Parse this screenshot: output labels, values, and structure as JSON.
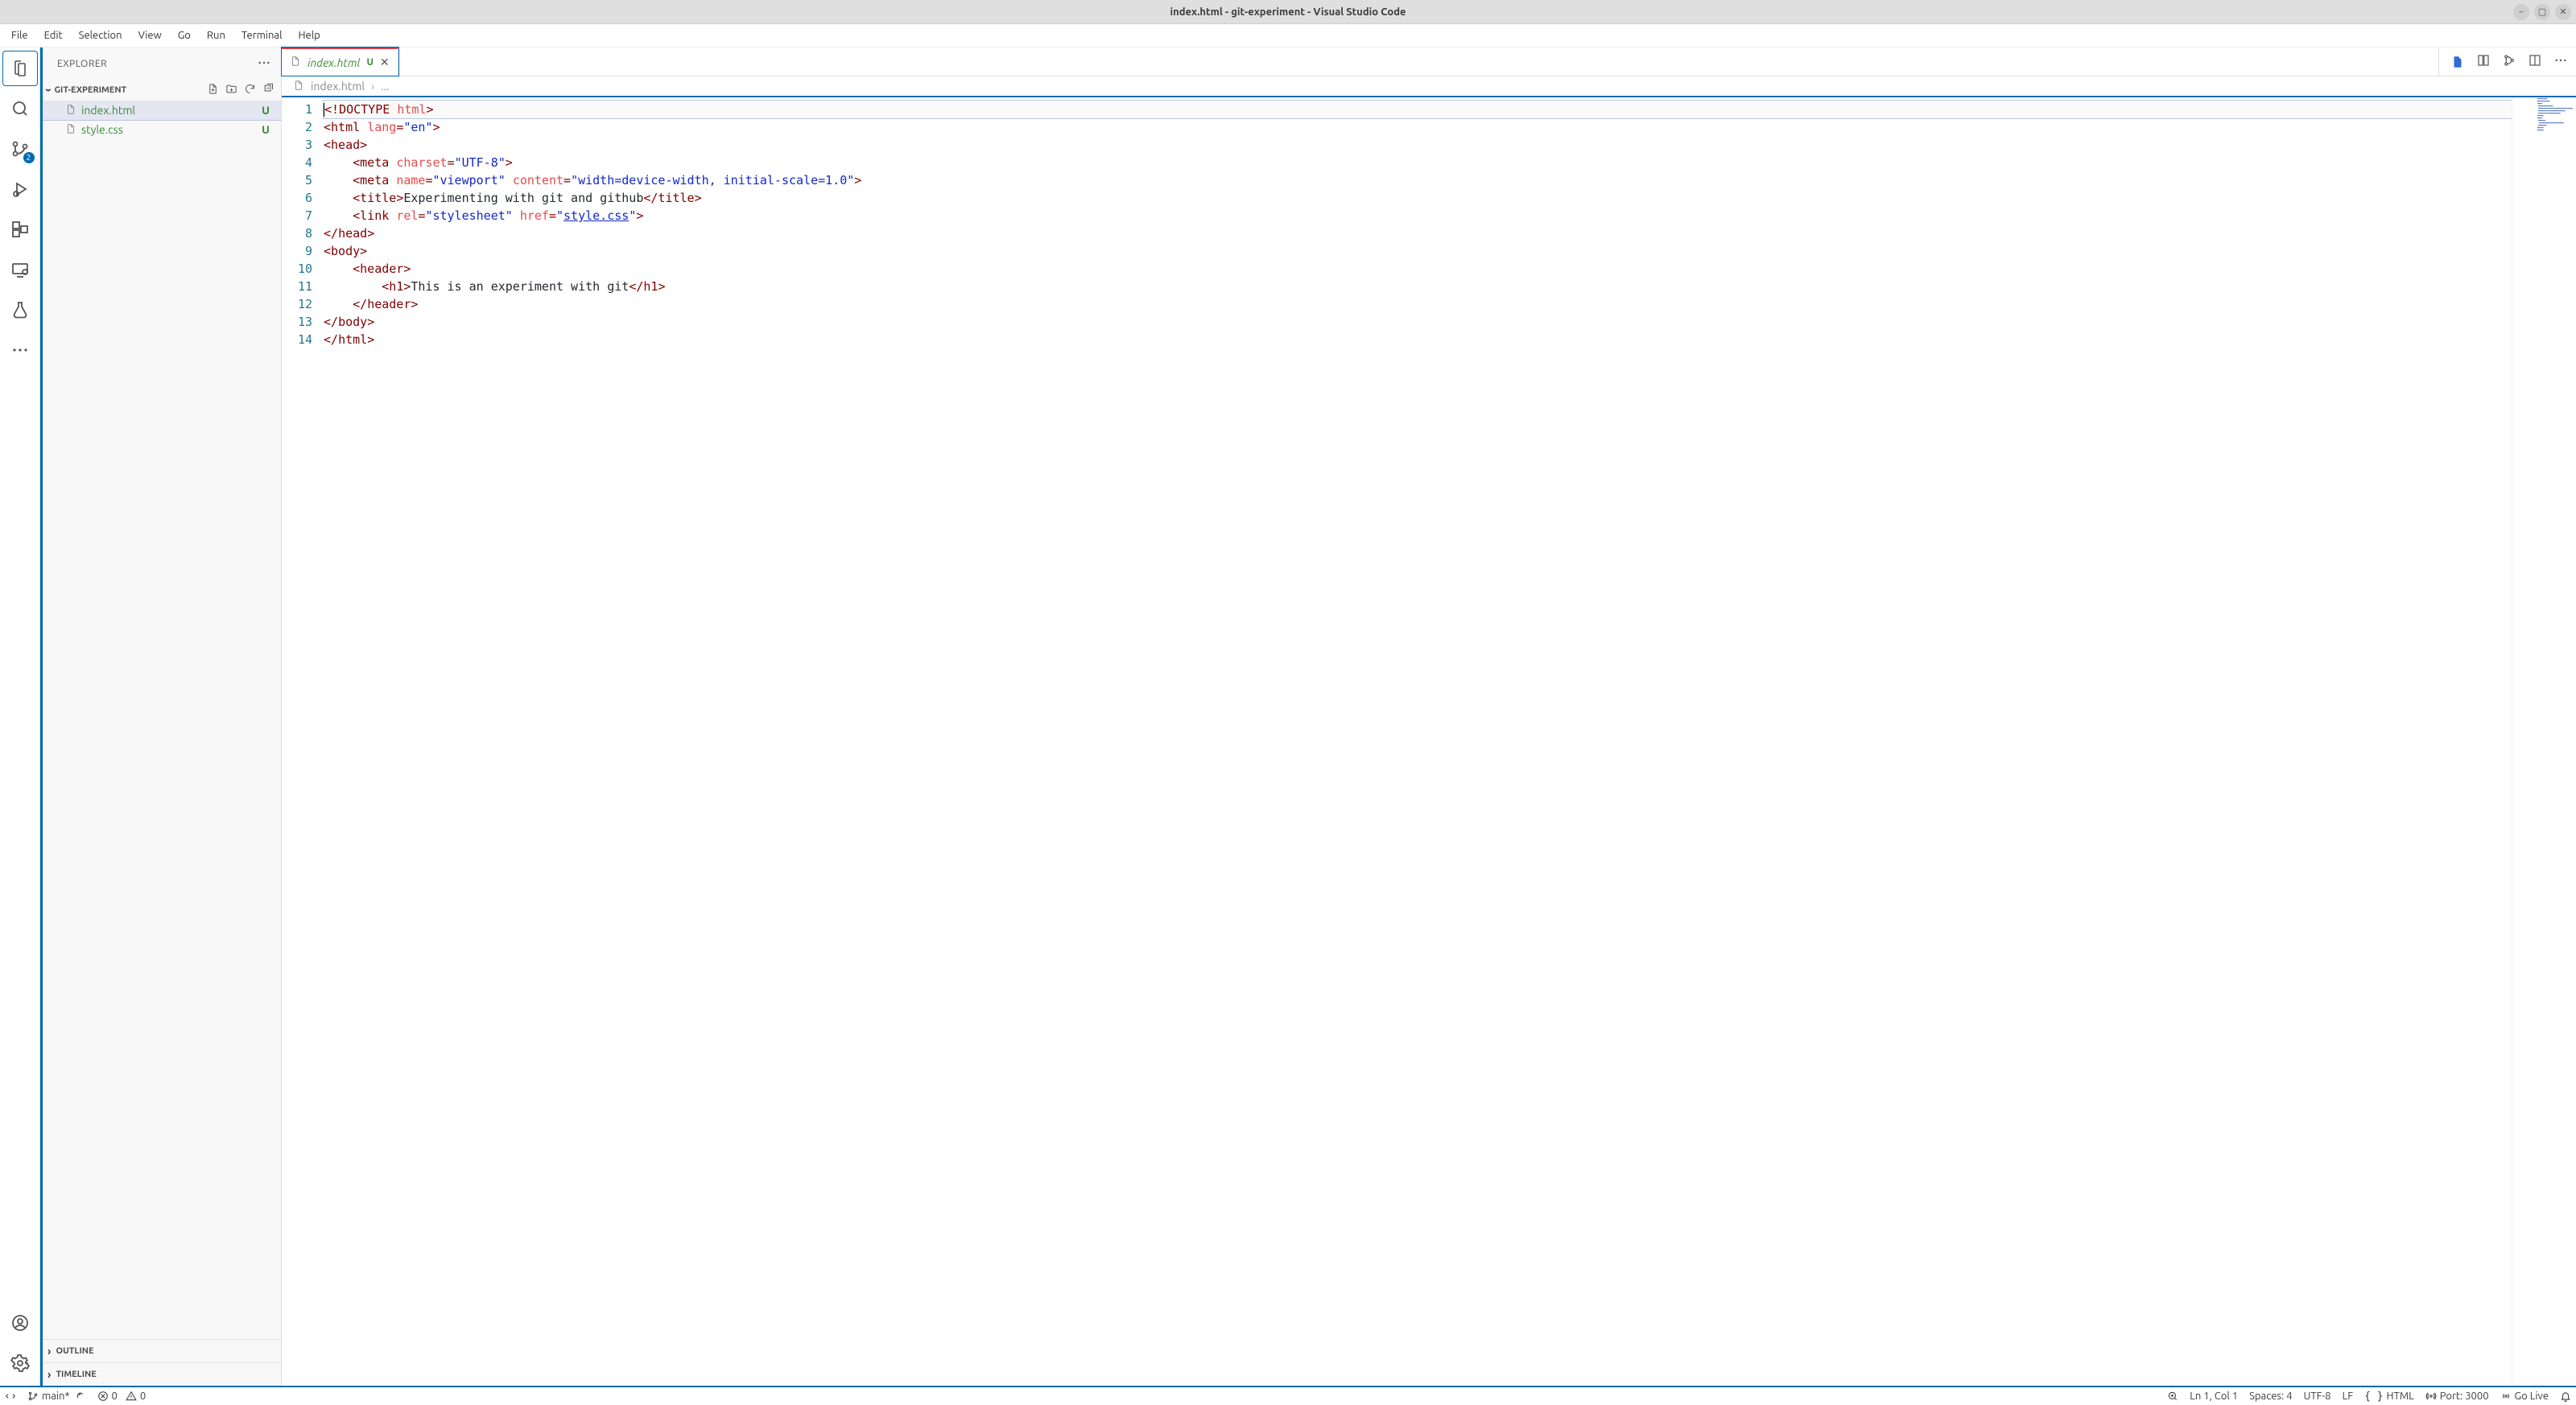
{
  "window": {
    "title": "index.html - git-experiment - Visual Studio Code"
  },
  "menu": [
    "File",
    "Edit",
    "Selection",
    "View",
    "Go",
    "Run",
    "Terminal",
    "Help"
  ],
  "activitybar": {
    "source_control_badge": "2"
  },
  "explorer": {
    "title": "EXPLORER",
    "folder": "GIT-EXPERIMENT",
    "files": [
      {
        "name": "index.html",
        "status": "U"
      },
      {
        "name": "style.css",
        "status": "U"
      }
    ],
    "sections": {
      "outline": "OUTLINE",
      "timeline": "TIMELINE"
    }
  },
  "tabs": [
    {
      "name": "index.html",
      "status": "U",
      "active": true
    }
  ],
  "breadcrumb": {
    "file": "index.html",
    "tail": "..."
  },
  "editor_lines": [
    [
      {
        "c": "p",
        "t": "<!"
      },
      {
        "c": "t",
        "t": "DOCTYPE"
      },
      {
        "c": "tx",
        "t": " "
      },
      {
        "c": "a",
        "t": "html"
      },
      {
        "c": "p",
        "t": ">"
      }
    ],
    [
      {
        "c": "p",
        "t": "<"
      },
      {
        "c": "t",
        "t": "html"
      },
      {
        "c": "tx",
        "t": " "
      },
      {
        "c": "a",
        "t": "lang"
      },
      {
        "c": "p",
        "t": "="
      },
      {
        "c": "v",
        "t": "\"en\""
      },
      {
        "c": "p",
        "t": ">"
      }
    ],
    [
      {
        "c": "p",
        "t": "<"
      },
      {
        "c": "t",
        "t": "head"
      },
      {
        "c": "p",
        "t": ">"
      }
    ],
    [
      {
        "c": "tx",
        "t": "    "
      },
      {
        "c": "p",
        "t": "<"
      },
      {
        "c": "t",
        "t": "meta"
      },
      {
        "c": "tx",
        "t": " "
      },
      {
        "c": "a",
        "t": "charset"
      },
      {
        "c": "p",
        "t": "="
      },
      {
        "c": "v",
        "t": "\"UTF-8\""
      },
      {
        "c": "p",
        "t": ">"
      }
    ],
    [
      {
        "c": "tx",
        "t": "    "
      },
      {
        "c": "p",
        "t": "<"
      },
      {
        "c": "t",
        "t": "meta"
      },
      {
        "c": "tx",
        "t": " "
      },
      {
        "c": "a",
        "t": "name"
      },
      {
        "c": "p",
        "t": "="
      },
      {
        "c": "v",
        "t": "\"viewport\""
      },
      {
        "c": "tx",
        "t": " "
      },
      {
        "c": "a",
        "t": "content"
      },
      {
        "c": "p",
        "t": "="
      },
      {
        "c": "v",
        "t": "\"width=device-width, initial-scale=1.0\""
      },
      {
        "c": "p",
        "t": ">"
      }
    ],
    [
      {
        "c": "tx",
        "t": "    "
      },
      {
        "c": "p",
        "t": "<"
      },
      {
        "c": "t",
        "t": "title"
      },
      {
        "c": "p",
        "t": ">"
      },
      {
        "c": "tx",
        "t": "Experimenting with git and github"
      },
      {
        "c": "p",
        "t": "</"
      },
      {
        "c": "t",
        "t": "title"
      },
      {
        "c": "p",
        "t": ">"
      }
    ],
    [
      {
        "c": "tx",
        "t": "    "
      },
      {
        "c": "p",
        "t": "<"
      },
      {
        "c": "t",
        "t": "link"
      },
      {
        "c": "tx",
        "t": " "
      },
      {
        "c": "a",
        "t": "rel"
      },
      {
        "c": "p",
        "t": "="
      },
      {
        "c": "v",
        "t": "\"stylesheet\""
      },
      {
        "c": "tx",
        "t": " "
      },
      {
        "c": "a",
        "t": "href"
      },
      {
        "c": "p",
        "t": "="
      },
      {
        "c": "v",
        "t": "\""
      },
      {
        "c": "v link",
        "t": "style.css"
      },
      {
        "c": "v",
        "t": "\""
      },
      {
        "c": "p",
        "t": ">"
      }
    ],
    [
      {
        "c": "p",
        "t": "</"
      },
      {
        "c": "t",
        "t": "head"
      },
      {
        "c": "p",
        "t": ">"
      }
    ],
    [
      {
        "c": "p",
        "t": "<"
      },
      {
        "c": "t",
        "t": "body"
      },
      {
        "c": "p",
        "t": ">"
      }
    ],
    [
      {
        "c": "tx",
        "t": "    "
      },
      {
        "c": "p",
        "t": "<"
      },
      {
        "c": "t",
        "t": "header"
      },
      {
        "c": "p",
        "t": ">"
      }
    ],
    [
      {
        "c": "tx",
        "t": "        "
      },
      {
        "c": "p",
        "t": "<"
      },
      {
        "c": "t",
        "t": "h1"
      },
      {
        "c": "p",
        "t": ">"
      },
      {
        "c": "tx",
        "t": "This is an experiment with git"
      },
      {
        "c": "p",
        "t": "</"
      },
      {
        "c": "t",
        "t": "h1"
      },
      {
        "c": "p",
        "t": ">"
      }
    ],
    [
      {
        "c": "tx",
        "t": "    "
      },
      {
        "c": "p",
        "t": "</"
      },
      {
        "c": "t",
        "t": "header"
      },
      {
        "c": "p",
        "t": ">"
      }
    ],
    [
      {
        "c": "p",
        "t": "</"
      },
      {
        "c": "t",
        "t": "body"
      },
      {
        "c": "p",
        "t": ">"
      }
    ],
    [
      {
        "c": "p",
        "t": "</"
      },
      {
        "c": "t",
        "t": "html"
      },
      {
        "c": "p",
        "t": ">"
      }
    ]
  ],
  "statusbar": {
    "branch": "main*",
    "errors": "0",
    "warnings": "0",
    "cursor": "Ln 1, Col 1",
    "spaces": "Spaces: 4",
    "encoding": "UTF-8",
    "eol": "LF",
    "language": "HTML",
    "port": "Port: 3000",
    "golive": "Go Live"
  }
}
